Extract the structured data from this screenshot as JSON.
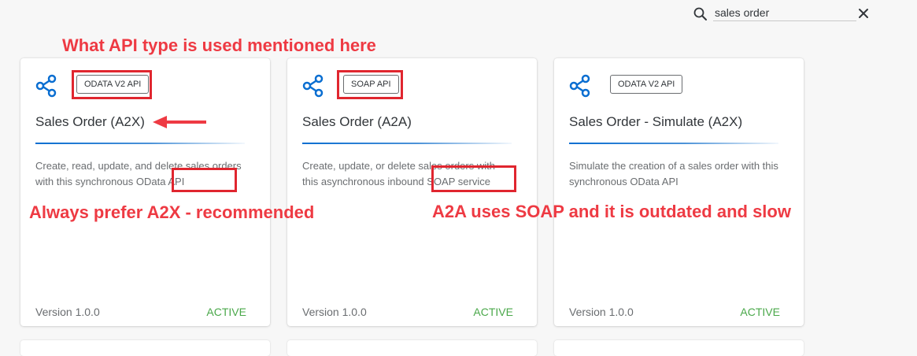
{
  "search": {
    "value": "sales order",
    "icon": "search-icon",
    "clear_icon": "close-icon"
  },
  "cards": [
    {
      "api_type": "ODATA V2 API",
      "title": "Sales Order (A2X)",
      "description": "Create, read, update, and delete sales orders with this synchronous OData API",
      "version": "Version 1.0.0",
      "status": "ACTIVE"
    },
    {
      "api_type": "SOAP API",
      "title": "Sales Order (A2A)",
      "description": "Create, update, or delete sales orders with this asynchronous inbound SOAP service",
      "version": "Version 1.0.0",
      "status": "ACTIVE"
    },
    {
      "api_type": "ODATA V2 API",
      "title": "Sales Order - Simulate (A2X)",
      "description": "Simulate the creation of a sales order with this synchronous OData API",
      "version": "Version 1.0.0",
      "status": "ACTIVE"
    }
  ],
  "annotations": {
    "top_note": "What API type is used mentioned here",
    "left_note": "Always prefer A2X - recommended",
    "right_note": "A2A uses SOAP and it is outdated and slow"
  },
  "colors": {
    "annotation": "#ee3a43",
    "status_active": "#4aa84a",
    "accent": "#0a6ed1",
    "icon_blue": "#0a6ed1"
  }
}
